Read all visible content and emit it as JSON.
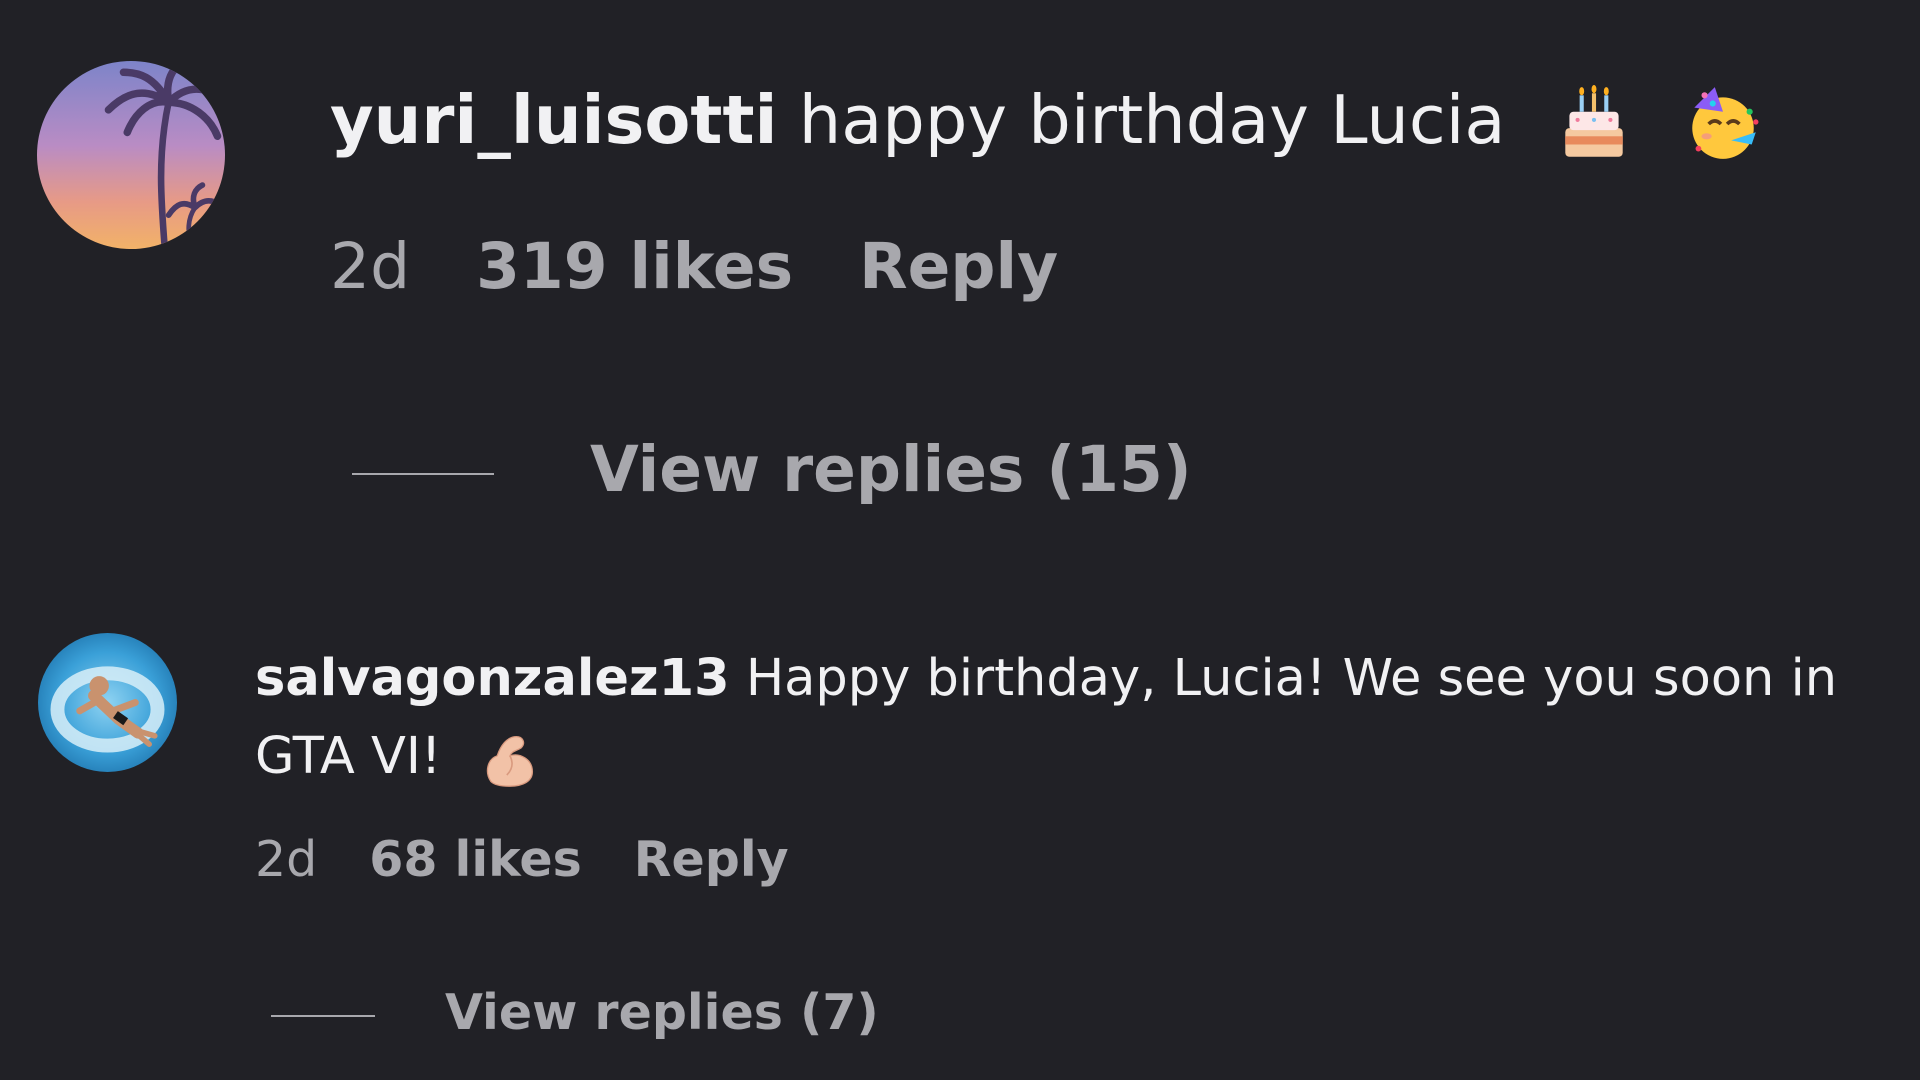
{
  "comments": [
    {
      "username": "yuri_luisotti",
      "text": "happy birthday Lucia",
      "emojis": [
        "birthday-cake-icon",
        "partying-face-icon"
      ],
      "time": "2d",
      "likes": "319 likes",
      "reply_label": "Reply",
      "view_replies": "View replies (15)"
    },
    {
      "username": "salvagonzalez13",
      "text": "Happy birthday, Lucia! We see you soon in GTA VI!",
      "emojis": [
        "flexed-biceps-icon"
      ],
      "time": "2d",
      "likes": "68 likes",
      "reply_label": "Reply",
      "view_replies": "View replies (7)"
    }
  ],
  "colors": {
    "background": "#212126",
    "primary_text": "#f1f1f3",
    "secondary_text": "#a8a8ad"
  }
}
